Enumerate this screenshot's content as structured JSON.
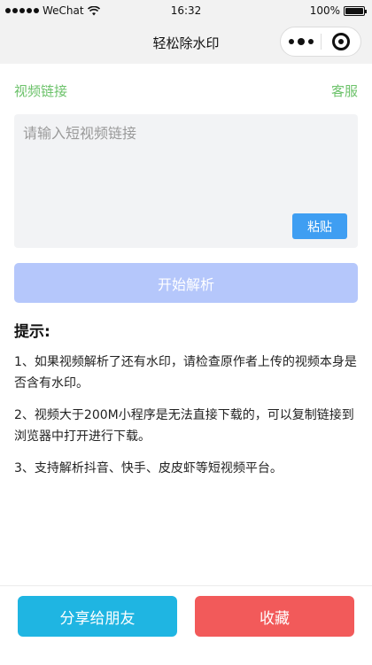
{
  "status_bar": {
    "carrier": "WeChat",
    "time": "16:32",
    "battery_text": "100%",
    "battery_level": 1.0
  },
  "nav": {
    "title": "轻松除水印"
  },
  "form": {
    "label": "视频链接",
    "service_link": "客服",
    "input_value": "",
    "input_placeholder": "请输入短视频链接",
    "paste_label": "粘贴",
    "parse_label": "开始解析"
  },
  "tips": {
    "title": "提示:",
    "items": [
      "1、如果视频解析了还有水印，请检查原作者上传的视频本身是否含有水印。",
      "2、视频大于200M小程序是无法直接下载的，可以复制链接到浏览器中打开进行下载。",
      "3、支持解析抖音、快手、皮皮虾等短视频平台。"
    ]
  },
  "bottom": {
    "share_label": "分享给朋友",
    "favorite_label": "收藏"
  },
  "colors": {
    "accent_green": "#6cc26a",
    "paste_blue": "#3f9ef2",
    "parse_disabled_blue": "#b5c7fb",
    "share_cyan": "#1fb5e2",
    "favorite_red": "#f25a5a"
  }
}
